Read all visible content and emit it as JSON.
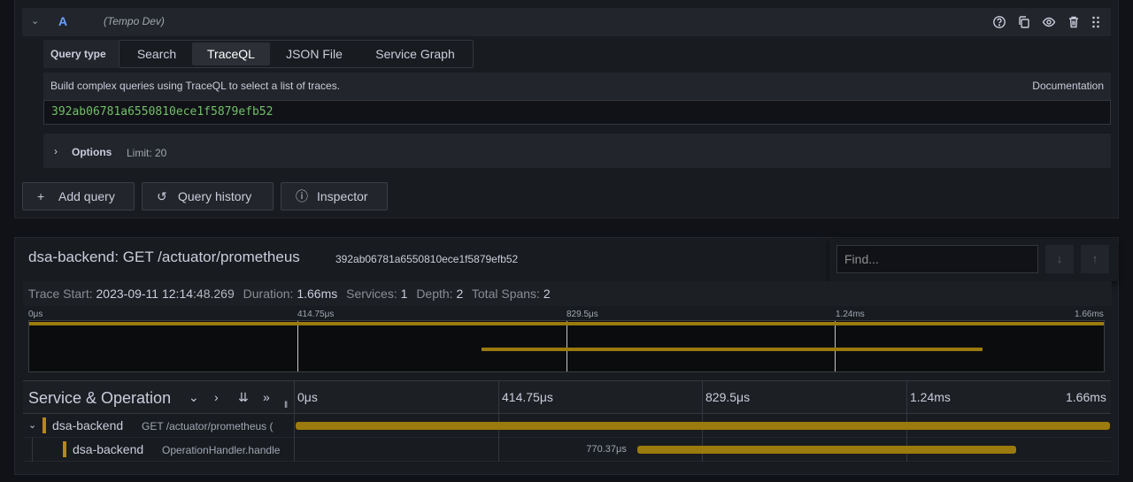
{
  "query_editor": {
    "query_letter": "A",
    "datasource": "(Tempo Dev)",
    "row_icons": [
      "help-icon",
      "copy-icon",
      "eye-icon",
      "trash-icon",
      "drag-handle-icon"
    ],
    "query_type_label": "Query type",
    "query_types": [
      "Search",
      "TraceQL",
      "JSON File",
      "Service Graph"
    ],
    "active_query_type": "TraceQL",
    "traceql_help": "Build complex queries using TraceQL to select a list of traces.",
    "documentation_link": "Documentation",
    "traceql_value": "392ab06781a6550810ece1f5879efb52",
    "options_label": "Options",
    "options_limit": "Limit: 20",
    "buttons": {
      "add_query": "Add query",
      "query_history": "Query history",
      "inspector": "Inspector"
    }
  },
  "trace": {
    "title": "dsa-backend: GET /actuator/prometheus",
    "trace_id": "392ab06781a6550810ece1f5879efb52",
    "find_placeholder": "Find...",
    "summary": {
      "start_label": "Trace Start:",
      "start_date": "2023-09-11",
      "start_time_hm": "12:14",
      "start_time_s": ":48.269",
      "duration_label": "Duration:",
      "duration": "1.66ms",
      "services_label": "Services:",
      "services": "1",
      "depth_label": "Depth:",
      "depth": "2",
      "total_spans_label": "Total Spans:",
      "total_spans": "2"
    },
    "minimap_ticks": [
      "0μs",
      "414.75μs",
      "829.5μs",
      "1.24ms",
      "1.66ms"
    ],
    "header_title": "Service & Operation",
    "timeline_ticks": [
      "0μs",
      "414.75μs",
      "829.5μs",
      "1.24ms",
      "1.66ms"
    ],
    "spans": [
      {
        "service": "dsa-backend",
        "operation": "GET /actuator/prometheus (",
        "start_fraction": 0.0,
        "duration_fraction": 1.0,
        "duration_label": ""
      },
      {
        "service": "dsa-backend",
        "operation": "OperationHandler.handle",
        "start_fraction": 0.42,
        "duration_fraction": 0.465,
        "duration_label": "770.37μs"
      }
    ],
    "colors": {
      "service_color": "#b58912",
      "span_bar": "#9b7a0e",
      "traceql_text": "#73bf69"
    }
  }
}
